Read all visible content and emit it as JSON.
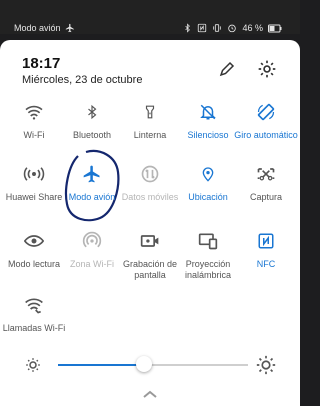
{
  "status_bar": {
    "left_text": "Modo avión",
    "battery": "46 %"
  },
  "header": {
    "time": "18:17",
    "date": "Miércoles, 23 de octubre"
  },
  "tiles": [
    {
      "label": "Wi-Fi",
      "icon": "wifi-icon",
      "state": "inactive"
    },
    {
      "label": "Bluetooth",
      "icon": "bluetooth-icon",
      "state": "inactive"
    },
    {
      "label": "Linterna",
      "icon": "flashlight-icon",
      "state": "inactive"
    },
    {
      "label": "Silencioso",
      "icon": "bell-off-icon",
      "state": "active"
    },
    {
      "label": "Giro automático",
      "icon": "auto-rotate-icon",
      "state": "active"
    },
    {
      "label": "Huawei Share",
      "icon": "huawei-share-icon",
      "state": "inactive"
    },
    {
      "label": "Modo avión",
      "icon": "airplane-icon",
      "state": "active"
    },
    {
      "label": "Datos móviles",
      "icon": "mobile-data-icon",
      "state": "disabled"
    },
    {
      "label": "Ubicación",
      "icon": "location-icon",
      "state": "active"
    },
    {
      "label": "Captura",
      "icon": "screenshot-icon",
      "state": "inactive"
    },
    {
      "label": "Modo lectura",
      "icon": "eye-icon",
      "state": "inactive"
    },
    {
      "label": "Zona Wi-Fi",
      "icon": "hotspot-icon",
      "state": "disabled"
    },
    {
      "label": "Grabación de pantalla",
      "icon": "screen-record-icon",
      "state": "inactive"
    },
    {
      "label": "Proyección inalámbrica",
      "icon": "projection-icon",
      "state": "inactive"
    },
    {
      "label": "NFC",
      "icon": "nfc-icon",
      "state": "active"
    },
    {
      "label": "Llamadas Wi-Fi",
      "icon": "wifi-calling-icon",
      "state": "inactive"
    }
  ],
  "brightness": {
    "level": 0.45
  },
  "colors": {
    "accent": "#1976d2",
    "inactive_icon": "#555555",
    "disabled": "#b5b5b5"
  }
}
